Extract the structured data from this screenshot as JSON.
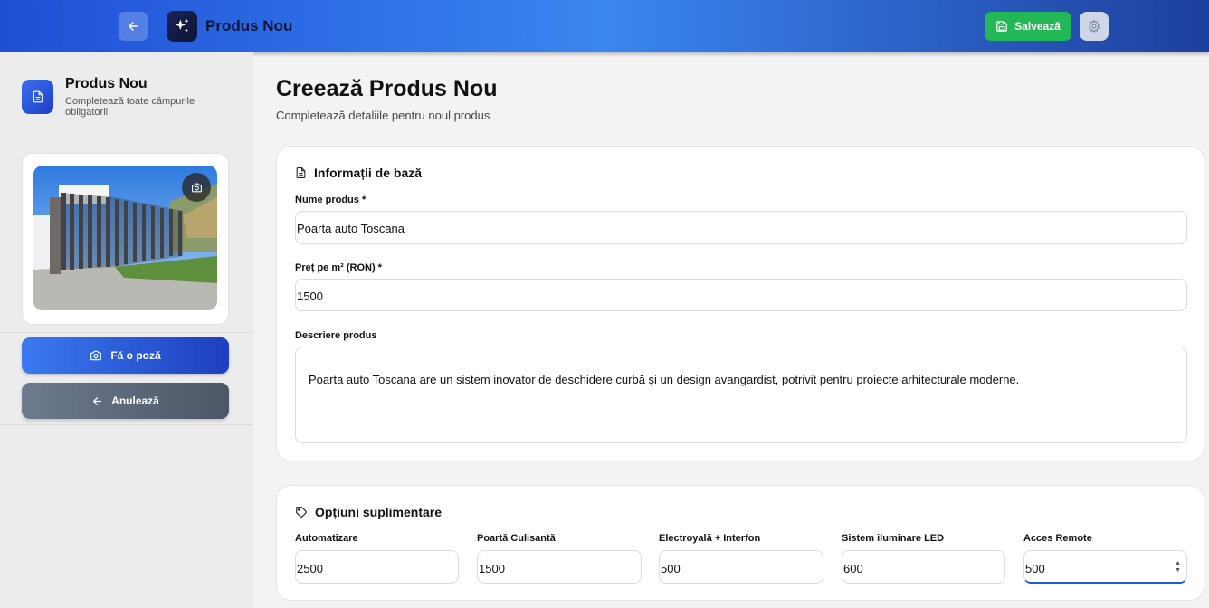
{
  "header": {
    "app_title": "Produs Nou",
    "save_label": "Salvează",
    "icons": {
      "back": "arrow-left-icon",
      "logo": "sparkles-icon",
      "save": "floppy-disk-icon",
      "settings": "gear-icon"
    },
    "colors": {
      "accent": "#2f6fe8",
      "save": "#22b856"
    }
  },
  "sidebar": {
    "title": "Produs Nou",
    "subtitle": "Completează toate câmpurile obligatorii",
    "photo_button": "Fă o poză",
    "cancel_button": "Anulează",
    "icons": {
      "document": "document-icon",
      "camera": "camera-icon",
      "back": "arrow-left-icon"
    }
  },
  "main": {
    "title": "Creează Produs Nou",
    "subtitle": "Completează detaliile pentru noul produs",
    "basic": {
      "title": "Informații de bază",
      "name_label": "Nume produs *",
      "name_value": "Poarta auto Toscana",
      "price_label": "Preț pe m² (RON) *",
      "price_value": "1500",
      "desc_label": "Descriere produs",
      "desc_value": "Poarta auto Toscana are un sistem inovator de deschidere curbă și un design avangardist, potrivit pentru proiecte arhitecturale moderne."
    },
    "options": {
      "title": "Opțiuni suplimentare",
      "items": [
        {
          "label": "Automatizare",
          "value": "2500"
        },
        {
          "label": "Poartă Culisantă",
          "value": "1500"
        },
        {
          "label": "Electroyală + Interfon",
          "value": "500"
        },
        {
          "label": "Sistem iluminare LED",
          "value": "600"
        },
        {
          "label": "Acces Remote",
          "value": "500"
        }
      ]
    }
  }
}
